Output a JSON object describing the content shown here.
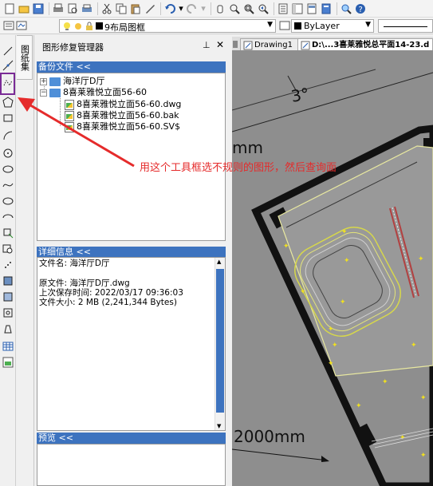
{
  "toolbar": {
    "layer_name": "9布局图框",
    "linetype": "ByLayer"
  },
  "sidebar_tab": "图纸集",
  "panel": {
    "title": "图形修复管理器",
    "pin": "ᵖ",
    "close": "✕",
    "backup_header": "备份文件 <<",
    "tree": [
      {
        "label": "海洋厅D厅"
      },
      {
        "label": "8喜莱雅悦立面56-60"
      },
      {
        "label": "8喜莱雅悦立面56-60.dwg"
      },
      {
        "label": "8喜莱雅悦立面56-60.bak"
      },
      {
        "label": "8喜莱雅悦立面56-60.SV$"
      }
    ],
    "detail_header": "详细信息 <<",
    "details": {
      "filename": "文件名: 海洋厅D厅",
      "original": "原文件: 海洋厅D厅.dwg",
      "saved": "上次保存时间:  2022/03/17   09:36:03",
      "size": "文件大小: 2 MB (2,241,344 Bytes)"
    },
    "preview_header": "预览 <<"
  },
  "doc_tabs": [
    "Drawing1",
    "D:\\...3喜莱雅悦总平面14-23.d"
  ],
  "drawing": {
    "angle_label": "3°",
    "dim_top": "mm",
    "dim_bottom": "2000mm"
  },
  "annotation": "用这个工具框选不规则的图形，然后查询面",
  "colors": {
    "header_blue": "#3d73bf",
    "annotation_red": "#e52b2b",
    "highlight_purple": "#7a2b96"
  }
}
